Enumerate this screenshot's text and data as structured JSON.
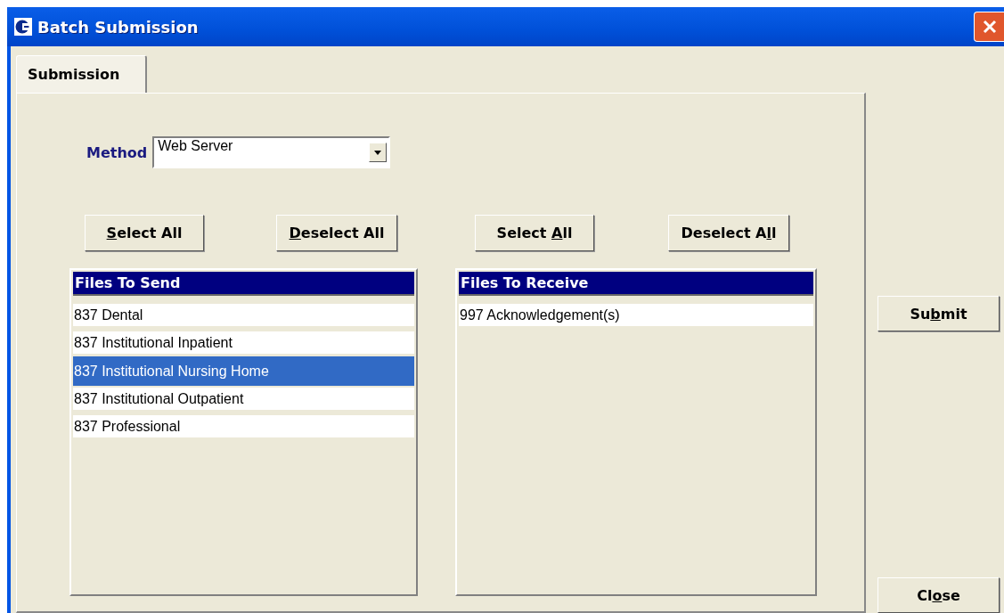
{
  "window": {
    "title": "Batch Submission"
  },
  "tabs": [
    {
      "label": "Submission",
      "selected": true
    }
  ],
  "method": {
    "label": "Method",
    "value": "Web Server"
  },
  "send_panel": {
    "buttons": [
      {
        "key": "S",
        "after": "elect All"
      },
      {
        "key": "D",
        "after": "eselect All"
      }
    ],
    "header": "Files To Send",
    "items": [
      {
        "label": "837 Dental",
        "selected": false
      },
      {
        "label": "837 Institutional Inpatient",
        "selected": false
      },
      {
        "label": "837 Institutional Nursing Home",
        "selected": true
      },
      {
        "label": "837 Institutional Outpatient",
        "selected": false
      },
      {
        "label": "837 Professional",
        "selected": false
      }
    ]
  },
  "receive_panel": {
    "buttons": [
      {
        "before": "Select ",
        "key": "A",
        "after": "ll"
      },
      {
        "before": "Deselect A",
        "key": "l",
        "after": "l"
      }
    ],
    "header": "Files To Receive",
    "items": [
      {
        "label": "997 Acknowledgement(s)",
        "selected": false
      }
    ]
  },
  "side_buttons": [
    {
      "before": "Su",
      "key": "b",
      "after": "mit"
    },
    {
      "before": "Cl",
      "key": "o",
      "after": "se"
    }
  ]
}
